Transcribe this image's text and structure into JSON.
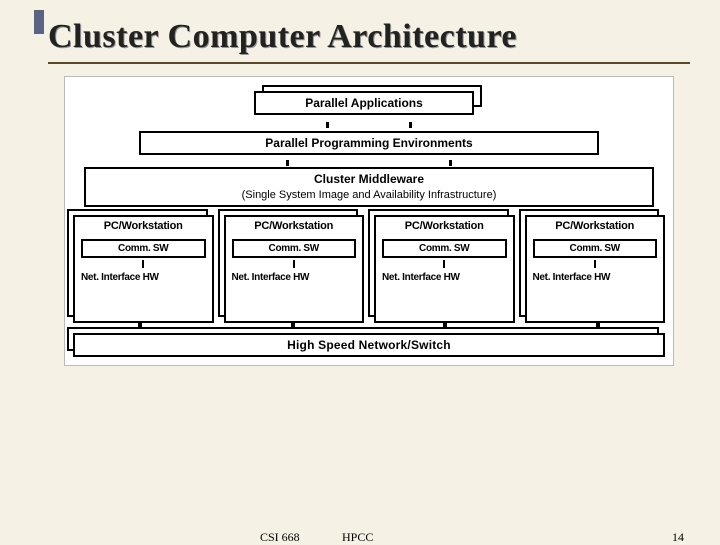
{
  "title": "Cluster Computer Architecture",
  "layers": {
    "parallel_apps": "Parallel Applications",
    "ppe": "Parallel Programming Environments",
    "middleware_title": "Cluster Middleware",
    "middleware_sub": "(Single System Image and Availability Infrastructure)",
    "hsn": "High Speed Network/Switch"
  },
  "node": {
    "title": "PC/Workstation",
    "comm": "Comm. SW",
    "net": "Net. Interface HW"
  },
  "footer": {
    "course": "CSI 668",
    "topic": "HPCC",
    "page": "14"
  }
}
